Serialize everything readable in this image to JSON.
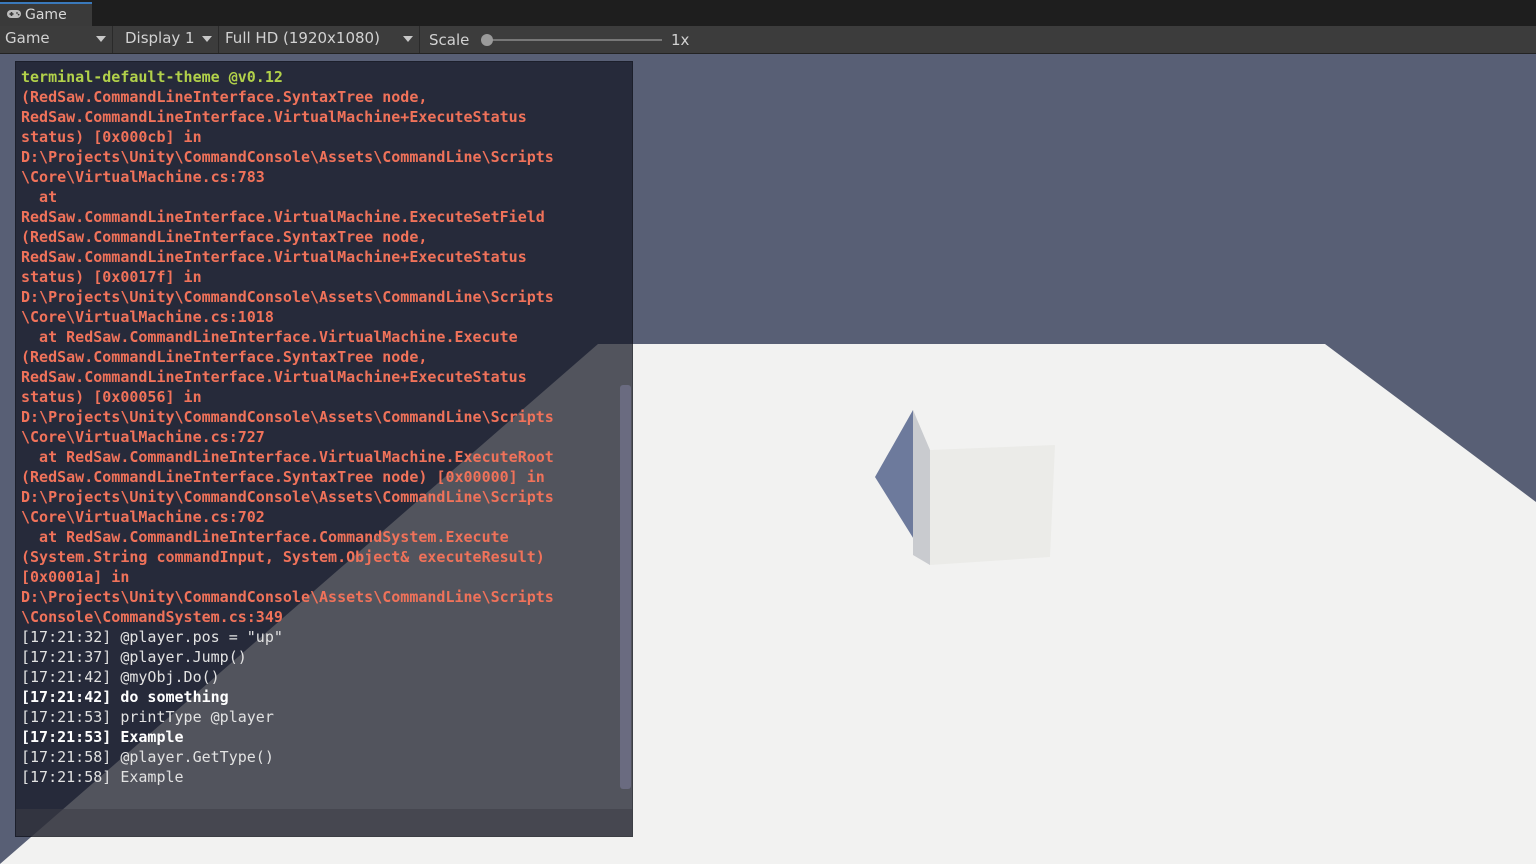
{
  "tab": {
    "icon": "gamepad-icon",
    "label": "Game"
  },
  "toolbar": {
    "view_select": "Game",
    "display_select": "Display 1",
    "resolution_select": "Full HD (1920x1080)",
    "scale_label": "Scale",
    "scale_value": "1x",
    "scale_slider_level": 0
  },
  "colors": {
    "sky": "#585f75",
    "ground": "#f2f2f1",
    "title": "#b2d14a",
    "error": "#f0725a",
    "command": "#e2e2e2"
  },
  "terminal": {
    "lines": [
      {
        "type": "title",
        "text": "terminal-default-theme @v0.12"
      },
      {
        "type": "err",
        "text": "(RedSaw.CommandLineInterface.SyntaxTree node,"
      },
      {
        "type": "err",
        "text": "RedSaw.CommandLineInterface.VirtualMachine+ExecuteStatus"
      },
      {
        "type": "err",
        "text": "status) [0x000cb] in"
      },
      {
        "type": "err",
        "text": "D:\\Projects\\Unity\\CommandConsole\\Assets\\CommandLine\\Scripts"
      },
      {
        "type": "err",
        "text": "\\Core\\VirtualMachine.cs:783"
      },
      {
        "type": "err",
        "text": "  at"
      },
      {
        "type": "err",
        "text": "RedSaw.CommandLineInterface.VirtualMachine.ExecuteSetField"
      },
      {
        "type": "err",
        "text": "(RedSaw.CommandLineInterface.SyntaxTree node,"
      },
      {
        "type": "err",
        "text": "RedSaw.CommandLineInterface.VirtualMachine+ExecuteStatus"
      },
      {
        "type": "err",
        "text": "status) [0x0017f] in"
      },
      {
        "type": "err",
        "text": "D:\\Projects\\Unity\\CommandConsole\\Assets\\CommandLine\\Scripts"
      },
      {
        "type": "err",
        "text": "\\Core\\VirtualMachine.cs:1018"
      },
      {
        "type": "err",
        "text": "  at RedSaw.CommandLineInterface.VirtualMachine.Execute"
      },
      {
        "type": "err",
        "text": "(RedSaw.CommandLineInterface.SyntaxTree node,"
      },
      {
        "type": "err",
        "text": "RedSaw.CommandLineInterface.VirtualMachine+ExecuteStatus"
      },
      {
        "type": "err",
        "text": "status) [0x00056] in"
      },
      {
        "type": "err",
        "text": "D:\\Projects\\Unity\\CommandConsole\\Assets\\CommandLine\\Scripts"
      },
      {
        "type": "err",
        "text": "\\Core\\VirtualMachine.cs:727"
      },
      {
        "type": "err",
        "text": "  at RedSaw.CommandLineInterface.VirtualMachine.ExecuteRoot"
      },
      {
        "type": "err",
        "text": "(RedSaw.CommandLineInterface.SyntaxTree node) [0x00000] in"
      },
      {
        "type": "err",
        "text": "D:\\Projects\\Unity\\CommandConsole\\Assets\\CommandLine\\Scripts"
      },
      {
        "type": "err",
        "text": "\\Core\\VirtualMachine.cs:702"
      },
      {
        "type": "err",
        "text": "  at RedSaw.CommandLineInterface.CommandSystem.Execute"
      },
      {
        "type": "err",
        "text": "(System.String commandInput, System.Object& executeResult)"
      },
      {
        "type": "err",
        "text": "[0x0001a] in"
      },
      {
        "type": "err",
        "text": "D:\\Projects\\Unity\\CommandConsole\\Assets\\CommandLine\\Scripts"
      },
      {
        "type": "err",
        "text": "\\Console\\CommandSystem.cs:349"
      },
      {
        "type": "cmd",
        "text": "[17:21:32] @player.pos = \"up\""
      },
      {
        "type": "cmd",
        "text": "[17:21:37] @player.Jump()"
      },
      {
        "type": "cmd",
        "text": "[17:21:42] @myObj.Do()"
      },
      {
        "type": "res",
        "text": "[17:21:42] do something"
      },
      {
        "type": "cmd",
        "text": "[17:21:53] printType @player"
      },
      {
        "type": "res",
        "text": "[17:21:53] Example"
      },
      {
        "type": "cmd",
        "text": "[17:21:58] @player.GetType()"
      },
      {
        "type": "cmd",
        "text": "[17:21:58] Example"
      }
    ],
    "input_value": ""
  }
}
